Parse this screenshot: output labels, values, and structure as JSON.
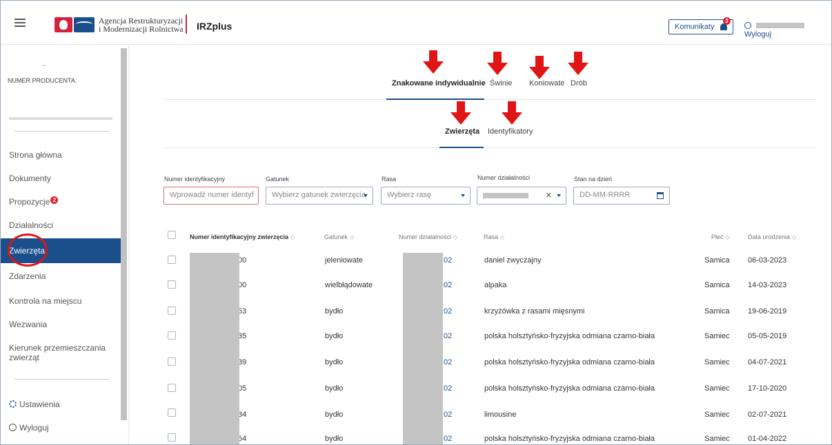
{
  "header": {
    "agency_line1": "Agencja Restrukturyzacji",
    "agency_line2": "i Modernizacji Rolnictwa",
    "app_title": "IRZplus",
    "messages_label": "Komunikaty",
    "messages_count": "3",
    "logout_label": "Wyloguj"
  },
  "sidebar": {
    "producer_label": "NUMER PRODUCENTA:",
    "items": [
      {
        "label": "Strona główna"
      },
      {
        "label": "Dokumenty"
      },
      {
        "label": "Propozycje",
        "badge": "2"
      },
      {
        "label": "Działalności"
      },
      {
        "label": "Zwierzęta",
        "active": true
      },
      {
        "label": "Zdarzenia"
      },
      {
        "label": "Kontrola na miejscu"
      },
      {
        "label": "Wezwania"
      },
      {
        "label": "Kierunek przemieszczania zwierząt"
      }
    ],
    "settings_label": "Ustawienia",
    "logout_label": "Wyloguj"
  },
  "tabs_primary": [
    "Znakowane indywidualnie",
    "Świnie",
    "Koniowate",
    "Drób"
  ],
  "tabs_secondary": [
    "Zwierzęta",
    "Identyfikatory"
  ],
  "filters": {
    "id": {
      "label": "Numer identyfikacyjny",
      "placeholder": "Wprowadź numer identyf"
    },
    "species": {
      "label": "Gatunek",
      "placeholder": "Wybierz gatunek zwierzęcia"
    },
    "breed": {
      "label": "Rasa",
      "placeholder": "Wybierz rasę"
    },
    "activity": {
      "label": "Numer działalności",
      "clear": "✕"
    },
    "date": {
      "label": "Stan na dzień",
      "placeholder": "DD-MM-RRRR"
    }
  },
  "table": {
    "columns": [
      "Numer identyfikacyjny zwierzęcia",
      "Gatunek",
      "Numer działalności",
      "Rasa",
      "Płeć",
      "Data urodzenia"
    ],
    "rows": [
      {
        "id_suffix": "00",
        "species": "jeleniowate",
        "activity_suffix": "02",
        "breed": "daniel zwyczajny",
        "sex": "Samica",
        "birth": "06-03-2023"
      },
      {
        "id_suffix": "00",
        "species": "wielbłądowate",
        "activity_suffix": "02",
        "breed": "alpaka",
        "sex": "Samica",
        "birth": "14-03-2023"
      },
      {
        "id_suffix": "53",
        "species": "bydło",
        "activity_suffix": "02",
        "breed": "krzyżówka z rasami mięsnymi",
        "sex": "Samica",
        "birth": "19-06-2019"
      },
      {
        "id_suffix": "35",
        "species": "bydło",
        "activity_suffix": "02",
        "breed": "polska holsztyńsko-fryzyjska odmiana czarno-biała",
        "sex": "Samiec",
        "birth": "05-05-2019"
      },
      {
        "id_suffix": "39",
        "species": "bydło",
        "activity_suffix": "02",
        "breed": "polska holsztyńsko-fryzyjska odmiana czarno-biała",
        "sex": "Samiec",
        "birth": "04-07-2021"
      },
      {
        "id_suffix": "05",
        "species": "bydło",
        "activity_suffix": "02",
        "breed": "polska holsztyńsko-fryzyjska odmiana czarno-biała",
        "sex": "Samiec",
        "birth": "17-10-2020"
      },
      {
        "id_suffix": "34",
        "species": "bydło",
        "activity_suffix": "02",
        "breed": "limousine",
        "sex": "Samiec",
        "birth": "02-07-2021"
      },
      {
        "id_suffix": "54",
        "species": "bydło",
        "activity_suffix": "02",
        "breed": "polska holsztyńsko-fryzyjska odmiana czarno-biała",
        "sex": "Samiec",
        "birth": "01-04-2022"
      }
    ]
  },
  "colors": {
    "primary": "#1b4f8c",
    "annotation_red": "#e01515",
    "badge": "#e0202e"
  }
}
